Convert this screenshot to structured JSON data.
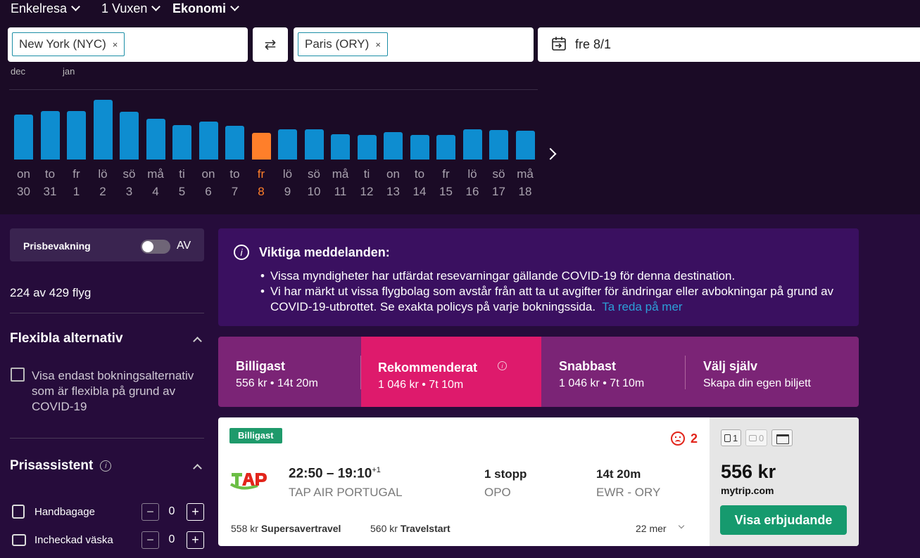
{
  "search": {
    "trip_type": "Enkelresa",
    "passengers": "1 Vuxen",
    "cabin": "Ekonomi",
    "origin": "New York (NYC)",
    "destination": "Paris (ORY)",
    "chip_remove": "×",
    "swap_symbol": "⇄",
    "date": "fre 8/1"
  },
  "calendar": {
    "months": [
      "dec",
      "jan"
    ],
    "days": [
      {
        "wd": "on",
        "d": "30",
        "price_level": 0.7
      },
      {
        "wd": "to",
        "d": "31",
        "price_level": 0.75
      },
      {
        "wd": "fr",
        "d": "1",
        "price_level": 0.75
      },
      {
        "wd": "lö",
        "d": "2",
        "price_level": 0.92
      },
      {
        "wd": "sö",
        "d": "3",
        "price_level": 0.74
      },
      {
        "wd": "må",
        "d": "4",
        "price_level": 0.63
      },
      {
        "wd": "ti",
        "d": "5",
        "price_level": 0.53
      },
      {
        "wd": "on",
        "d": "6",
        "price_level": 0.59
      },
      {
        "wd": "to",
        "d": "7",
        "price_level": 0.52
      },
      {
        "wd": "fr",
        "d": "8",
        "price_level": 0.41,
        "selected": true
      },
      {
        "wd": "lö",
        "d": "9",
        "price_level": 0.47
      },
      {
        "wd": "sö",
        "d": "10",
        "price_level": 0.47
      },
      {
        "wd": "må",
        "d": "11",
        "price_level": 0.39
      },
      {
        "wd": "ti",
        "d": "12",
        "price_level": 0.38
      },
      {
        "wd": "on",
        "d": "13",
        "price_level": 0.42
      },
      {
        "wd": "to",
        "d": "14",
        "price_level": 0.38
      },
      {
        "wd": "fr",
        "d": "15",
        "price_level": 0.38
      },
      {
        "wd": "lö",
        "d": "16",
        "price_level": 0.47
      },
      {
        "wd": "sö",
        "d": "17",
        "price_level": 0.46
      },
      {
        "wd": "må",
        "d": "18",
        "price_level": 0.45
      }
    ],
    "bar_color": "#0e8dd0",
    "selected_color": "#ff7f2a"
  },
  "filters": {
    "price_alert_label": "Prisbevakning",
    "price_alert_state": "AV",
    "flight_count": "224 av 429 flyg",
    "flex_title": "Flexibla alternativ",
    "flex_checkbox": "Visa endast bokningsalternativ som är flexibla på grund av COVID-19",
    "assistant_title": "Prisassistent",
    "info_symbol": "i",
    "hand_bag": "Handbagage",
    "hand_bag_count": "0",
    "checked_bag": "Incheckad väska",
    "checked_bag_count": "0",
    "minus": "−",
    "plus": "+"
  },
  "notice": {
    "title": "Viktiga meddelanden:",
    "line1": "Vissa myndigheter har utfärdat resevarningar gällande COVID-19 för denna destination.",
    "line2": "Vi har märkt ut vissa flygbolag som avstår från att ta ut avgifter för ändringar eller avbokningar på grund av COVID-19-utbrottet. Se exakta policys på varje bokningssida.",
    "link": "Ta reda på mer"
  },
  "sort_tabs": [
    {
      "title": "Billigast",
      "sub": "556 kr • 14t 20m"
    },
    {
      "title": "Rekommenderat",
      "sub": "1 046 kr • 7t 10m"
    },
    {
      "title": "Snabbast",
      "sub": "1 046 kr • 7t 10m"
    },
    {
      "title": "Välj själv",
      "sub": "Skapa din egen biljett"
    }
  ],
  "result": {
    "badge": "Billigast",
    "warnings": "2",
    "time": "22:50 – 19:10",
    "next_day": "+1",
    "airline": "TAP AIR PORTUGAL",
    "stops": "1 stopp",
    "stop_airport": "OPO",
    "duration": "14t 20m",
    "route": "EWR - ORY",
    "alt1_price": "558 kr",
    "alt1_site": "Supersavertravel",
    "alt2_price": "560 kr",
    "alt2_site": "Travelstart",
    "more": "22 mer",
    "carry_on": "1",
    "checked": "0",
    "price": "556 kr",
    "provider": "mytrip.com",
    "cta": "Visa erbjudande",
    "logo_text": "TAP"
  }
}
